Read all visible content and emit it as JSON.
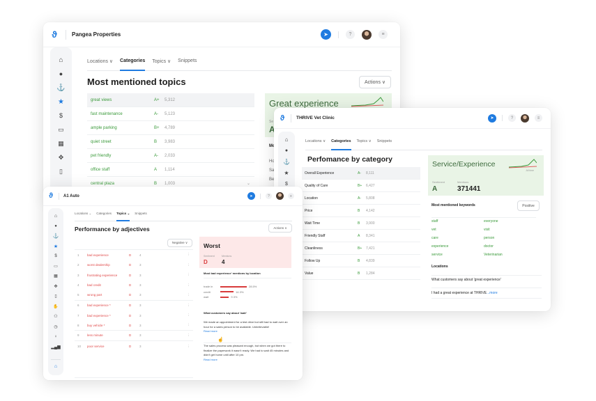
{
  "pangea": {
    "title": "Pangea Properties",
    "tabs": [
      {
        "label": "Locations ∨",
        "active": false
      },
      {
        "label": "Categories",
        "active": true
      },
      {
        "label": "Topics ∨",
        "active": false
      },
      {
        "label": "Snippets",
        "active": false
      }
    ],
    "heading": "Most mentioned topics",
    "actions_label": "Actions ∨",
    "rows": [
      {
        "topic": "great views",
        "grade": "A+",
        "count": "5,312"
      },
      {
        "topic": "fast maintenance",
        "grade": "A-",
        "count": "5,123"
      },
      {
        "topic": "ample parking",
        "grade": "B+",
        "count": "4,789"
      },
      {
        "topic": "quiet street",
        "grade": "B",
        "count": "3,983"
      },
      {
        "topic": "pet friendly",
        "grade": "A-",
        "count": "2,033"
      },
      {
        "topic": "office staff",
        "grade": "A",
        "count": "1,114"
      },
      {
        "topic": "central plaza",
        "grade": "B",
        "count": "1,003"
      }
    ],
    "card": {
      "title": "Great experience",
      "sentiment_label": "Se",
      "sentiment_value": "A",
      "keywords_label": "Mo",
      "locations": [
        "Ho",
        "Sa",
        "Be"
      ]
    }
  },
  "thrive": {
    "title": "THRIVE Vet Clinic",
    "tabs": [
      {
        "label": "Locations ∨",
        "active": false
      },
      {
        "label": "Categories",
        "active": true
      },
      {
        "label": "Topics ∨",
        "active": false
      },
      {
        "label": "Snippets",
        "active": false
      }
    ],
    "heading": "Perfomance by category",
    "rows": [
      {
        "category": "Overall Experience",
        "grade": "A-",
        "count": "8,111"
      },
      {
        "category": "Quality of Care",
        "grade": "B+",
        "count": "6,427"
      },
      {
        "category": "Location",
        "grade": "A-",
        "count": "5,808"
      },
      {
        "category": "Price",
        "grade": "B",
        "count": "4,142"
      },
      {
        "category": "Wait Time",
        "grade": "B",
        "count": "3,900"
      },
      {
        "category": "Friendly Staff",
        "grade": "A",
        "count": "8,341"
      },
      {
        "category": "Cleanliness",
        "grade": "B+",
        "count": "7,421"
      },
      {
        "category": "Follow Up",
        "grade": "B",
        "count": "4,839"
      },
      {
        "category": "Value",
        "grade": "B",
        "count": "1,284"
      }
    ],
    "card": {
      "title": "Service/Experience",
      "sparkline_label": "All time",
      "sentiment_label": "Sentiment",
      "sentiment_value": "A",
      "mentions_label": "Mentions",
      "mentions_value": "371441"
    },
    "keywords_label": "Most mentioned keywords",
    "filter_label": "Positive",
    "keywords": [
      "staff",
      "everyone",
      "vet",
      "visit",
      "care",
      "person",
      "experience",
      "doctor",
      "service",
      "Veterinarian"
    ],
    "locations_label": "Locations",
    "snippet_heading": "What customers say about 'great experience'",
    "snippet_text": "I had a great experience at THRIVE",
    "snippet_more": "...more"
  },
  "a1": {
    "title": "A1 Auto",
    "tabs": [
      {
        "label": "Locations ⌄",
        "active": false
      },
      {
        "label": "Categories",
        "active": false
      },
      {
        "label": "Topics ⌄",
        "active": true
      },
      {
        "label": "Snippets",
        "active": false
      }
    ],
    "heading": "Performance by adjectives",
    "actions_label": "Actions ∨",
    "filter_label": "Negative ∨",
    "rows": [
      {
        "rank": "1",
        "adjective": "bad experience",
        "grade": "D",
        "count": "4"
      },
      {
        "rank": "2",
        "adjective": "worst dealership",
        "grade": "D",
        "count": "3"
      },
      {
        "rank": "3",
        "adjective": "frustrating experience",
        "grade": "D",
        "count": "3"
      },
      {
        "rank": "4",
        "adjective": "bad credit",
        "grade": "D",
        "count": "3"
      },
      {
        "rank": "5",
        "adjective": "wrong part",
        "grade": "D",
        "count": "3"
      },
      {
        "rank": "6",
        "adjective": "bad experience *",
        "grade": "D",
        "count": "3"
      },
      {
        "rank": "7",
        "adjective": "bad experience *",
        "grade": "D",
        "count": "3"
      },
      {
        "rank": "8",
        "adjective": "buy vehicle *",
        "grade": "D",
        "count": "3"
      },
      {
        "rank": "9",
        "adjective": "less minute",
        "grade": "D",
        "count": "3"
      },
      {
        "rank": "10",
        "adjective": "poor service",
        "grade": "D",
        "count": "3"
      }
    ],
    "card": {
      "title": "Worst",
      "sentiment_label": "Sentiment",
      "sentiment_value": "D",
      "mentions_label": "Mentions",
      "mentions_value": "4"
    },
    "location_heading": "Most bad experience' mentions by location",
    "location_bars": [
      {
        "label": "trade in",
        "value": "28.5%",
        "pct": 28.5
      },
      {
        "label": "credit",
        "value": "14.3%",
        "pct": 14.3
      },
      {
        "label": "wait",
        "value": "9.3%",
        "pct": 9.3
      }
    ],
    "snippets_heading": "What customers say about 'wait'",
    "snippets": [
      {
        "text": "We made an appointment for a test drive but still had to wait over an hour for a sales person to be available. Unbelievable!",
        "link": "Read more"
      },
      {
        "text": "The sales process was pleasant enough, but when we got there to finalize the paperwork it wasn't ready. We had to wait 45 minutes and didn't get home until after 10 pm.",
        "link": "Read more"
      }
    ]
  },
  "icons": {
    "sidebar": [
      "home-icon",
      "chat-icon",
      "anchor-icon",
      "star-icon",
      "dollar-icon",
      "calendar-icon",
      "grid-icon",
      "network-icon",
      "document-icon",
      "hand-icon",
      "people-icon",
      "clock-icon",
      "bulb-icon",
      "bar-chart-icon"
    ],
    "colors": {
      "brand": "#1f7be0",
      "positive": "#3a9a3a",
      "negative": "#e04848"
    }
  }
}
